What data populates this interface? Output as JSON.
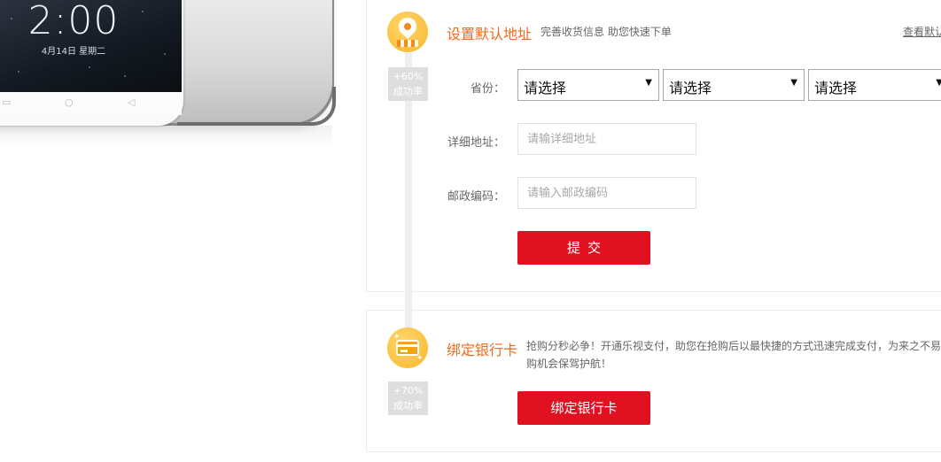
{
  "phone": {
    "time": "2:00",
    "date": "4月14日  星期二",
    "nav_icons": [
      "menu-key-icon",
      "home-key-icon",
      "back-key-icon"
    ]
  },
  "address_step": {
    "title": "设置默认地址",
    "subtitle": "完善收货信息 助您快速下单",
    "view_default_link": "查看默认",
    "success_rate": "+60%",
    "success_label": "成功率",
    "icon": "location-pin-icon",
    "fields": {
      "province_label": "省份：",
      "province_selects": [
        "请选择",
        "请选择",
        "请选择"
      ],
      "detail_label": "详细地址：",
      "detail_placeholder": "请输详细地址",
      "detail_value": "",
      "zip_label": "邮政编码：",
      "zip_placeholder": "请输入邮政编码",
      "zip_value": ""
    },
    "submit_label": "提交"
  },
  "bank_step": {
    "title": "绑定银行卡",
    "description_line1": "抢购分秒必争！开通乐视支付，助您在抢购后以最快捷的方式迅速完成支付，为来之不易",
    "description_line2": "购机会保驾护航！",
    "success_rate": "+70%",
    "success_label": "成功率",
    "icon": "bank-card-icon",
    "button_label": "绑定银行卡"
  },
  "colors": {
    "accent_red": "#e01222",
    "title_orange": "#f26a1b",
    "icon_yellow": "#f7b52c",
    "badge_gray": "#dedede"
  }
}
